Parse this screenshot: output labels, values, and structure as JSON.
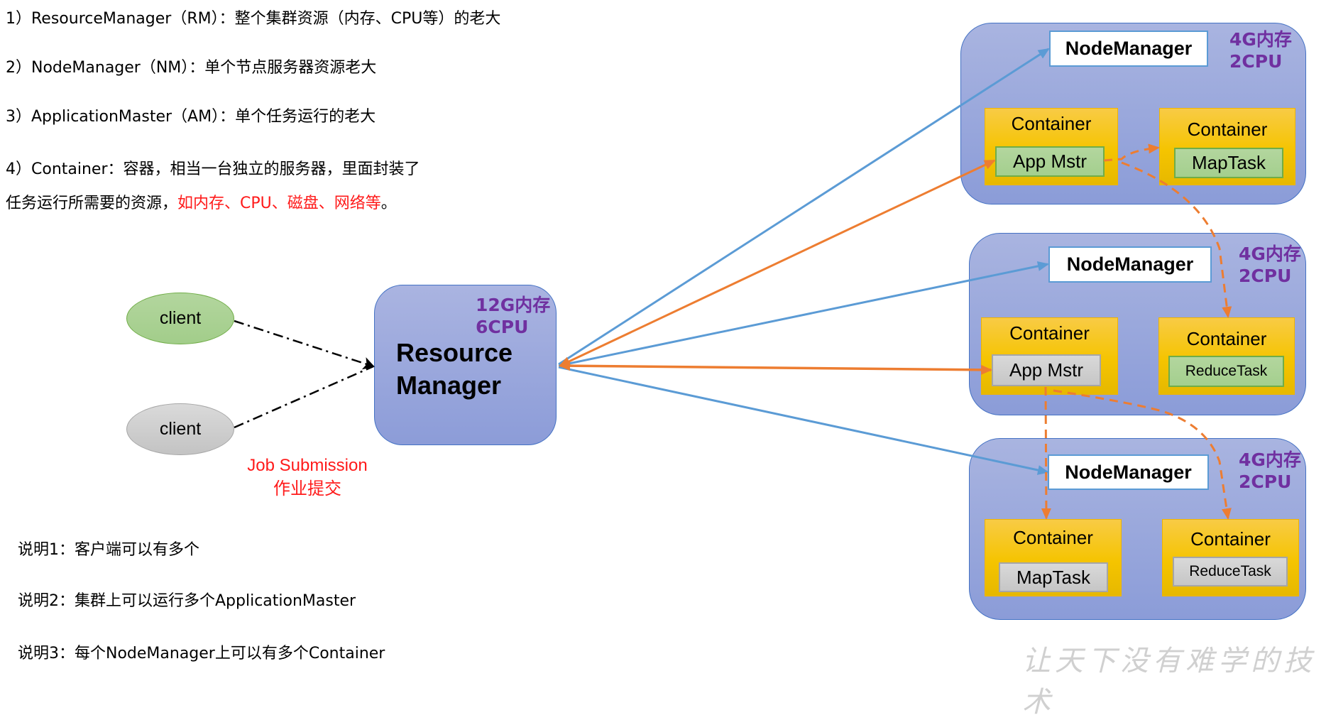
{
  "definitions": [
    {
      "text": "1）ResourceManager（RM）：整个集群资源（内存、CPU等）的老大"
    },
    {
      "text": "2）NodeManager（NM）：单个节点服务器资源老大"
    },
    {
      "text": "3）ApplicationMaster（AM）：单个任务运行的老大"
    },
    {
      "text": "4）Container：容器，相当一台独立的服务器，里面封装了"
    },
    {
      "text": "任务运行所需要的资源，",
      "highlight": "如内存、CPU、磁盘、网络等",
      "tail": "。"
    }
  ],
  "clients": [
    {
      "label": "client",
      "color": "#a9d18e"
    },
    {
      "label": "client",
      "color": "#d0d0d0"
    }
  ],
  "job_submission": {
    "en": "Job Submission",
    "zh": "作业提交"
  },
  "resource_manager": {
    "title_line1": "Resource",
    "title_line2": "Manager",
    "spec_line1": "12G内存",
    "spec_line2": "6CPU"
  },
  "node_managers": [
    {
      "label": "NodeManager",
      "spec_line1": "4G内存",
      "spec_line2": "2CPU",
      "containers": [
        {
          "label": "Container",
          "task": "App Mstr",
          "task_color": "green"
        },
        {
          "label": "Container",
          "task": "MapTask",
          "task_color": "green"
        }
      ]
    },
    {
      "label": "NodeManager",
      "spec_line1": "4G内存",
      "spec_line2": "2CPU",
      "containers": [
        {
          "label": "Container",
          "task": "App Mstr",
          "task_color": "gray"
        },
        {
          "label": "Container",
          "task": "ReduceTask",
          "task_color": "green"
        }
      ]
    },
    {
      "label": "NodeManager",
      "spec_line1": "4G内存",
      "spec_line2": "2CPU",
      "containers": [
        {
          "label": "Container",
          "task": "MapTask",
          "task_color": "gray"
        },
        {
          "label": "Container",
          "task": "ReduceTask",
          "task_color": "gray"
        }
      ]
    }
  ],
  "notes": [
    "说明1：客户端可以有多个",
    "说明2：集群上可以运行多个ApplicationMaster",
    "说明3：每个NodeManager上可以有多个Container"
  ],
  "watermark": "让天下没有难学的技术",
  "colors": {
    "blue_arrow": "#5b9bd5",
    "orange_arrow": "#ed7d31",
    "spec_purple": "#7030a0",
    "highlight_red": "#ff1a1a"
  }
}
